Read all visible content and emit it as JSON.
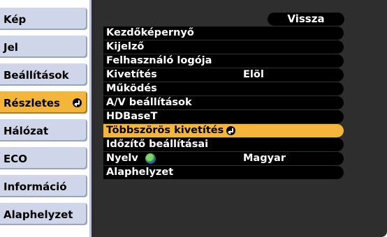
{
  "sidebar": {
    "items": [
      {
        "label": "Kép"
      },
      {
        "label": "Jel"
      },
      {
        "label": "Beállítások"
      },
      {
        "label": "Részletes"
      },
      {
        "label": "Hálózat"
      },
      {
        "label": "ECO"
      },
      {
        "label": "Információ"
      },
      {
        "label": "Alaphelyzet"
      }
    ]
  },
  "header": {
    "back_label": "Vissza"
  },
  "menu": {
    "items": [
      {
        "label": "Kezdőképernyő",
        "value": ""
      },
      {
        "label": "Kijelző",
        "value": ""
      },
      {
        "label": "Felhasználó logója",
        "value": ""
      },
      {
        "label": "Kivetítés",
        "value": "Elöl"
      },
      {
        "label": "Működés",
        "value": ""
      },
      {
        "label": "A/V beállítások",
        "value": ""
      },
      {
        "label": "HDBaseT",
        "value": ""
      },
      {
        "label": "Többszörös kivetítés",
        "value": ""
      },
      {
        "label": "Időzítő beállításai",
        "value": ""
      },
      {
        "label": "Nyelv",
        "value": "Magyar"
      },
      {
        "label": "Alaphelyzet",
        "value": ""
      }
    ],
    "selected_label": "Többszörös kivetítés"
  },
  "colors": {
    "accent": "#f4b63a",
    "sidebar": "#cfd6ea",
    "panel": "#2e2e2e"
  }
}
